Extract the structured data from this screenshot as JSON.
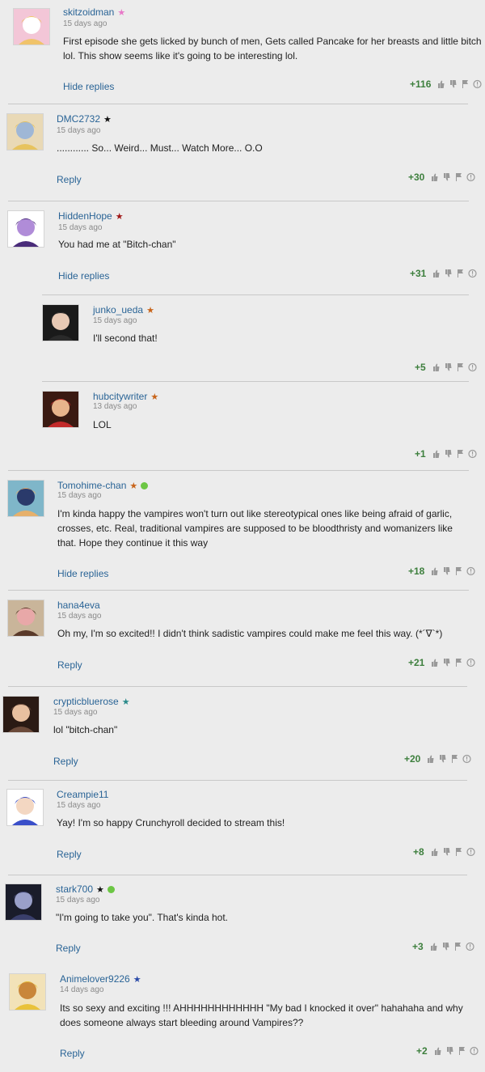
{
  "comments": [
    {
      "username": "skitzoidman",
      "badge": "pink-star",
      "date": "15 days ago",
      "text": "First episode she gets licked by bunch of men, Gets called Pancake for her breasts and little bitch lol. This show seems like it's going to be interesting lol.",
      "action": "Hide replies",
      "votes": "+116"
    },
    {
      "username": "DMC2732",
      "badge": "black-star",
      "date": "15 days ago",
      "text": "............ So... Weird... Must... Watch More... O.O",
      "action": "Reply",
      "votes": "+30"
    },
    {
      "username": "HiddenHope",
      "badge": "red-star",
      "date": "15 days ago",
      "text": "You had me at \"Bitch-chan\"",
      "action": "Hide replies",
      "votes": "+31"
    },
    {
      "username": "junko_ueda",
      "badge": "orange-star",
      "date": "15 days ago",
      "text": "I'll second that!",
      "action": "",
      "votes": "+5"
    },
    {
      "username": "hubcitywriter",
      "badge": "orange-star",
      "date": "13 days ago",
      "text": "LOL",
      "action": "",
      "votes": "+1"
    },
    {
      "username": "Tomohime-chan",
      "badge": "orange-star",
      "date": "15 days ago",
      "text": "I'm kinda happy the vampires won't turn out like stereotypical ones like being afraid of garlic, crosses, etc. Real, traditional vampires are supposed to be bloodthristy and womanizers like that. Hope they continue it this way",
      "action": "Hide replies",
      "votes": "+18"
    },
    {
      "username": "hana4eva",
      "badge": "",
      "date": "15 days ago",
      "text": "Oh my, I'm so excited!! I didn't think sadistic vampires could make me feel this way. (*´∇`*)",
      "action": "Reply",
      "votes": "+21"
    },
    {
      "username": "crypticbluerose",
      "badge": "teal-star",
      "date": "15 days ago",
      "text": "lol \"bitch-chan\"",
      "action": "Reply",
      "votes": "+20"
    },
    {
      "username": "Creampie11",
      "badge": "",
      "date": "15 days ago",
      "text": "Yay! I'm so happy Crunchyroll decided to stream this!",
      "action": "Reply",
      "votes": "+8"
    },
    {
      "username": "stark700",
      "badge": "black-star",
      "date": "15 days ago",
      "text": "\"I'm going to take you\". That's kinda hot.",
      "action": "Reply",
      "votes": "+3"
    },
    {
      "username": "Animelover9226",
      "badge": "blue-star",
      "date": "14 days ago",
      "text": "Its so sexy and exciting !!! AHHHHHHHHHHHH \"My bad I knocked it over\" hahahaha and why does someone always start bleeding around Vampires??",
      "action": "Reply",
      "votes": "+2"
    }
  ],
  "icons": {
    "upvote": "thumbs-up-icon",
    "downvote": "thumbs-down-icon",
    "flag": "flag-icon",
    "report": "report-icon"
  },
  "colors": {
    "link": "#2a6496",
    "votes": "#3d7f3d",
    "background": "#ececec"
  }
}
